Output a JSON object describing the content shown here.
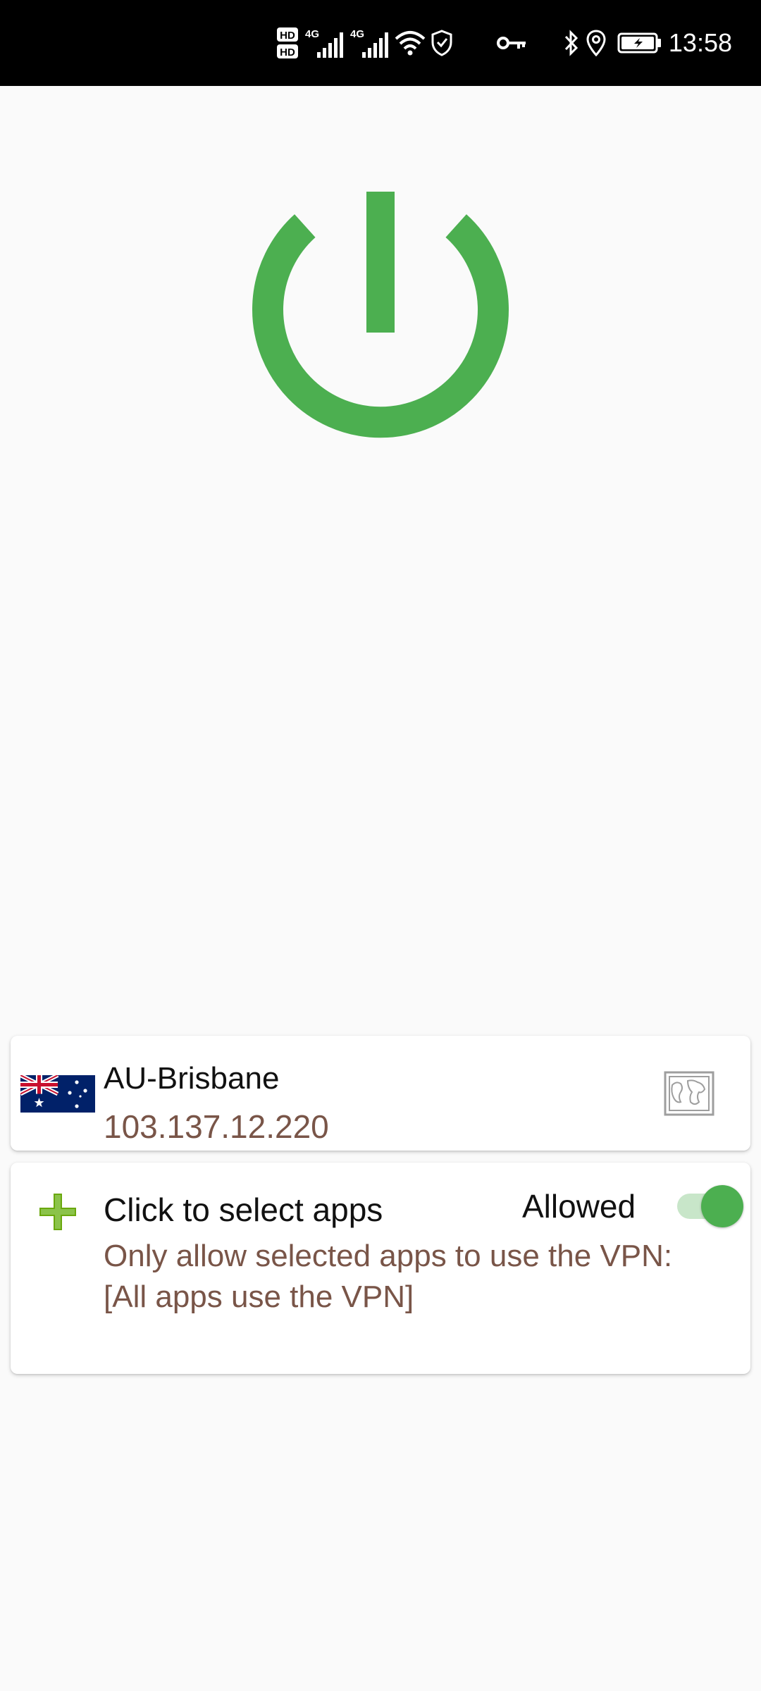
{
  "status_bar": {
    "time": "13:58",
    "icons": [
      "hd-icon",
      "4g-signal-icon",
      "4g-signal-icon",
      "wifi-icon",
      "shield-icon",
      "vpn-key-icon",
      "bluetooth-icon",
      "location-icon",
      "battery-charging-icon"
    ],
    "network_labels": [
      "HD",
      "4G"
    ]
  },
  "power": {
    "color": "#4caf50",
    "icon": "power-icon"
  },
  "server": {
    "name": "AU-Brisbane",
    "ip": "103.137.12.220",
    "flag_icon": "australia-flag-icon",
    "map_icon": "map-icon"
  },
  "apps": {
    "title": "Click to select apps",
    "toggle_label": "Allowed",
    "toggle_on": true,
    "description_line1": "Only allow selected apps to use the VPN:",
    "description_line2": "[All apps use the VPN]",
    "add_icon": "plus-icon"
  },
  "colors": {
    "accent": "#4caf50",
    "secondary_text": "#795548",
    "status_bar": "#000000"
  }
}
